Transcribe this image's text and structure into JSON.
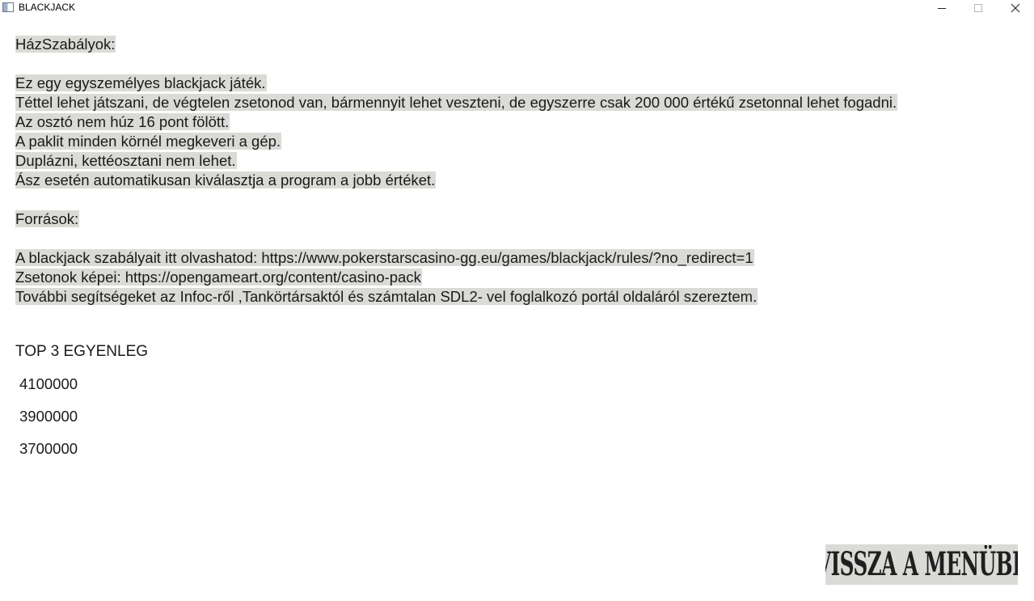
{
  "window": {
    "title": "BLACKJACK",
    "icon": "window-app-icon",
    "controls": [
      "minimize-icon",
      "maximize-icon",
      "close-icon"
    ]
  },
  "rules": {
    "heading": "HázSzabályok:",
    "lines": [
      "Ez egy egyszemélyes blackjack játék.",
      "Téttel lehet játszani, de végtelen zsetonod van, bármennyit lehet veszteni, de egyszerre csak 200 000 értékű zsetonnal lehet fogadni.",
      "Az osztó nem húz 16 pont fölött.",
      "A paklit minden körnél megkeveri a gép.",
      "Duplázni, kettéosztani nem lehet.",
      "Ász esetén automatikusan kiválasztja a program a jobb értéket."
    ]
  },
  "sources": {
    "heading": "Források:",
    "lines": [
      "A blackjack szabályait itt olvashatod: https://www.pokerstarscasino-gg.eu/games/blackjack/rules/?no_redirect=1 ",
      "Zsetonok képei: https://opengameart.org/content/casino-pack",
      "További segítségeket az Infoc-ről ,Tankörtársaktól és számtalan SDL2- vel foglalkozó portál oldaláról szereztem."
    ]
  },
  "leaderboard": {
    "title": "TOP 3 EGYENLEG",
    "scores": [
      "4100000",
      "3900000",
      "3700000"
    ]
  },
  "actions": {
    "back_label": "VISSZA A MENÜBE"
  },
  "colors": {
    "highlight": "#dadad6",
    "text": "#1a1a1a",
    "background": "#ffffff"
  }
}
